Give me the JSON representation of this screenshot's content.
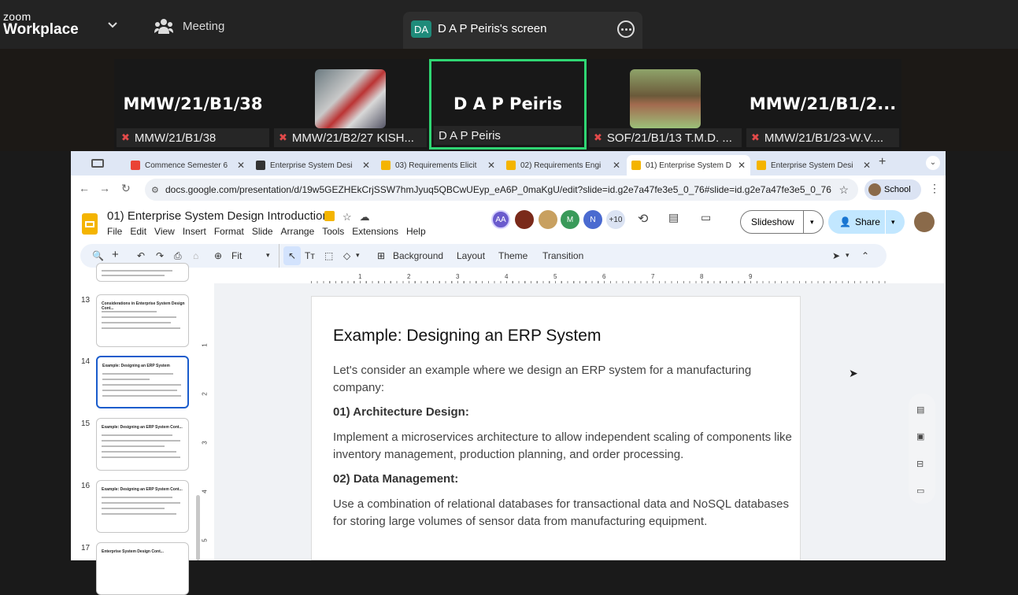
{
  "zoom": {
    "logo_top": "zoom",
    "logo_bottom": "Workplace",
    "meeting_label": "Meeting",
    "share_initials": "DA",
    "share_label": "D A P Peiris's screen"
  },
  "participants": [
    {
      "big": "MMW/21/B1/38",
      "name": "MMW/21/B1/38",
      "muted": true
    },
    {
      "big": "",
      "name": "MMW/21/B2/27 KISH...",
      "muted": true
    },
    {
      "big": "D A P Peiris",
      "name": "D A P Peiris",
      "muted": false
    },
    {
      "big": "",
      "name": "SOF/21/B1/13 T.M.D. ...",
      "muted": true
    },
    {
      "big": "MMW/21/B1/2...",
      "name": "MMW/21/B1/23-W.V....",
      "muted": true
    }
  ],
  "browser": {
    "tabs": [
      {
        "title": "Commence Semester 6",
        "fav": "#ea4335"
      },
      {
        "title": "Enterprise System Desi",
        "fav": "#333333"
      },
      {
        "title": "03) Requirements Elicit",
        "fav": "#f4b400"
      },
      {
        "title": "02) Requirements Engi",
        "fav": "#f4b400"
      },
      {
        "title": "01) Enterprise System D",
        "fav": "#f4b400"
      },
      {
        "title": "Enterprise System Desi",
        "fav": "#f4b400"
      }
    ],
    "url": "docs.google.com/presentation/d/19w5GEZHEkCrjSSW7hmJyuq5QBCwUEyp_eA6P_0maKgU/edit?slide=id.g2e7a47fe3e5_0_76#slide=id.g2e7a47fe3e5_0_76",
    "profile": "School"
  },
  "slides": {
    "doc_title": "01) Enterprise System Design Introduction",
    "menu": [
      "File",
      "Edit",
      "View",
      "Insert",
      "Format",
      "Slide",
      "Arrange",
      "Tools",
      "Extensions",
      "Help"
    ],
    "collab_initials": [
      "AA",
      "M",
      "N"
    ],
    "collab_more": "+10",
    "slideshow": "Slideshow",
    "share": "Share",
    "zoom_fit": "Fit",
    "toolbar_btns": [
      "Background",
      "Layout",
      "Theme",
      "Transition"
    ],
    "ruler_nums": [
      "1",
      "2",
      "3",
      "4",
      "5",
      "6",
      "7",
      "8",
      "9"
    ],
    "vruler_nums": [
      "1",
      "2",
      "3",
      "4",
      "5"
    ],
    "thumb_nums": [
      "13",
      "14",
      "15",
      "16",
      "17"
    ],
    "thumb_titles": [
      "Considerations in Enterprise System Design Cont...",
      "Example: Designing an ERP System",
      "Example: Designing an ERP System Cont...",
      "Example: Designing an ERP System Cont...",
      "Enterprise System Design Cont..."
    ]
  },
  "slide": {
    "title": "Example: Designing an ERP System",
    "intro": "Let's consider an example where we design an ERP system for a manufacturing company:",
    "h1": "01) Architecture Design:",
    "p1": "Implement a microservices architecture to allow independent scaling of components like inventory management, production planning, and order processing.",
    "h2": "02) Data Management:",
    "p2": "Use a combination of relational databases for transactional data and NoSQL databases for storing large volumes of sensor data from manufacturing equipment."
  }
}
